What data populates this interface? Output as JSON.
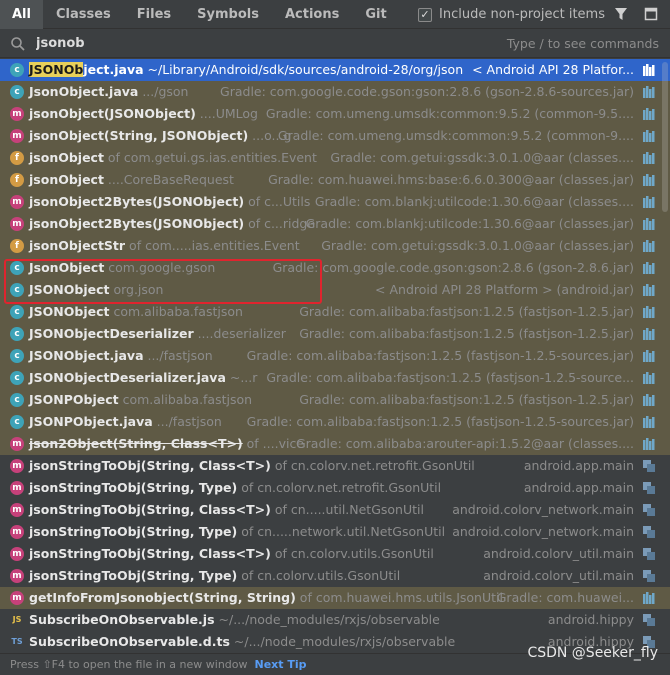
{
  "tabs": [
    "All",
    "Classes",
    "Files",
    "Symbols",
    "Actions",
    "Git"
  ],
  "include_label": "Include non-project items",
  "include_checked": "✓",
  "search": {
    "value": "jsonob",
    "hint": "Type / to see commands"
  },
  "results": [
    {
      "icon": "c",
      "pre": "",
      "match": "JSONOb",
      "post": "ject.java",
      "loc": " ~/Library/Android/sdk/sources/android-28/org/json",
      "src": "< Android API 28 Platfor...",
      "bg": "selected",
      "lib": true
    },
    {
      "icon": "c",
      "pre": "",
      "match": "",
      "post": "JsonObject.java",
      "loc": " .../gson",
      "src": "Gradle: com.google.code.gson:gson:2.8.6 (gson-2.8.6-sources.jar)",
      "bg": "lib",
      "lib": true
    },
    {
      "icon": "m",
      "pre": "",
      "match": "",
      "post": "jsonObject(JSONObject)",
      "loc": " ....UMLog",
      "src": "Gradle: com.umeng.umsdk:common:9.5.2 (common-9.5....",
      "bg": "lib",
      "lib": true
    },
    {
      "icon": "m",
      "pre": "",
      "match": "",
      "post": "jsonObject(String, JSONObject)",
      "loc": " ...o...g",
      "src": "Gradle: com.umeng.umsdk:common:9.5.2 (common-9....",
      "bg": "lib",
      "lib": true
    },
    {
      "icon": "f",
      "pre": "",
      "match": "",
      "post": "jsonObject",
      "loc": " of com.getui.gs.ias.entities.Event",
      "src": "Gradle: com.getui:gssdk:3.0.1.0@aar (classes....",
      "bg": "lib",
      "lib": true
    },
    {
      "icon": "f",
      "pre": "",
      "match": "",
      "post": "jsonObject",
      "loc": " ....CoreBaseRequest",
      "src": "Gradle: com.huawei.hms:base:6.6.0.300@aar (classes.jar)",
      "bg": "lib",
      "lib": true
    },
    {
      "icon": "m",
      "pre": "",
      "match": "",
      "post": "jsonObject2Bytes(JSONObject)",
      "loc": " of c...Utils",
      "src": "Gradle: com.blankj:utilcode:1.30.6@aar (classes....",
      "bg": "lib",
      "lib": true
    },
    {
      "icon": "m",
      "pre": "",
      "match": "",
      "post": "jsonObject2Bytes(JSONObject)",
      "loc": " of c...ridge",
      "src": "Gradle: com.blankj:utilcode:1.30.6@aar (classes.jar)",
      "bg": "lib",
      "lib": true
    },
    {
      "icon": "f",
      "pre": "",
      "match": "",
      "post": "jsonObjectStr",
      "loc": " of com.....ias.entities.Event",
      "src": "Gradle: com.getui:gssdk:3.0.1.0@aar (classes.jar)",
      "bg": "lib",
      "lib": true
    },
    {
      "icon": "c",
      "pre": "",
      "match": "",
      "post": "JsonObject",
      "loc": " com.google.gson",
      "src": "Gradle: com.google.code.gson:gson:2.8.6 (gson-2.8.6.jar)",
      "bg": "lib",
      "lib": true
    },
    {
      "icon": "c",
      "pre": "",
      "match": "",
      "post": "JSONObject",
      "loc": " org.json",
      "src": "< Android API 28 Platform > (android.jar)",
      "bg": "lib",
      "lib": true
    },
    {
      "icon": "c",
      "pre": "",
      "match": "",
      "post": "JSONObject",
      "loc": " com.alibaba.fastjson",
      "src": "Gradle: com.alibaba:fastjson:1.2.5 (fastjson-1.2.5.jar)",
      "bg": "lib",
      "lib": true
    },
    {
      "icon": "c",
      "pre": "",
      "match": "",
      "post": "JSONObjectDeserializer",
      "loc": " ....deserializer",
      "src": "Gradle: com.alibaba:fastjson:1.2.5 (fastjson-1.2.5.jar)",
      "bg": "lib",
      "lib": true
    },
    {
      "icon": "c",
      "pre": "",
      "match": "",
      "post": "JSONObject.java",
      "loc": " .../fastjson",
      "src": "Gradle: com.alibaba:fastjson:1.2.5 (fastjson-1.2.5-sources.jar)",
      "bg": "lib",
      "lib": true
    },
    {
      "icon": "c",
      "pre": "",
      "match": "",
      "post": "JSONObjectDeserializer.java",
      "loc": " ~...r",
      "src": "Gradle: com.alibaba:fastjson:1.2.5 (fastjson-1.2.5-source...",
      "bg": "lib",
      "lib": true
    },
    {
      "icon": "c",
      "pre": "",
      "match": "",
      "post": "JSONPObject",
      "loc": " com.alibaba.fastjson",
      "src": "Gradle: com.alibaba:fastjson:1.2.5 (fastjson-1.2.5.jar)",
      "bg": "lib",
      "lib": true
    },
    {
      "icon": "c",
      "pre": "",
      "match": "",
      "post": "JSONPObject.java",
      "loc": " .../fastjson",
      "src": "Gradle: com.alibaba:fastjson:1.2.5 (fastjson-1.2.5-sources.jar)",
      "bg": "lib",
      "lib": true
    },
    {
      "icon": "m",
      "pre": "",
      "match": "",
      "post": "json2Object(String, Class<T>)",
      "loc": " of ....vice",
      "src": "Gradle: com.alibaba:arouter-api:1.5.2@aar (classes....",
      "bg": "lib",
      "lib": true,
      "strike": true
    },
    {
      "icon": "m",
      "pre": "",
      "match": "",
      "post": "jsonStringToObj(String, Class<T>)",
      "loc": " of cn.colorv.net.retrofit.GsonUtil",
      "src": "android.app.main",
      "bg": "plain",
      "lib": false
    },
    {
      "icon": "m",
      "pre": "",
      "match": "",
      "post": "jsonStringToObj(String, Type)",
      "loc": " of cn.colorv.net.retrofit.GsonUtil",
      "src": "android.app.main",
      "bg": "plain",
      "lib": false
    },
    {
      "icon": "m",
      "pre": "",
      "match": "",
      "post": "jsonStringToObj(String, Class<T>)",
      "loc": " of cn.....util.NetGsonUtil",
      "src": "android.colorv_network.main",
      "bg": "plain",
      "lib": false
    },
    {
      "icon": "m",
      "pre": "",
      "match": "",
      "post": "jsonStringToObj(String, Type)",
      "loc": " of cn.....network.util.NetGsonUtil",
      "src": "android.colorv_network.main",
      "bg": "plain",
      "lib": false
    },
    {
      "icon": "m",
      "pre": "",
      "match": "",
      "post": "jsonStringToObj(String, Class<T>)",
      "loc": " of cn.colorv.utils.GsonUtil",
      "src": "android.colorv_util.main",
      "bg": "plain",
      "lib": false
    },
    {
      "icon": "m",
      "pre": "",
      "match": "",
      "post": "jsonStringToObj(String, Type)",
      "loc": " of cn.colorv.utils.GsonUtil",
      "src": "android.colorv_util.main",
      "bg": "plain",
      "lib": false
    },
    {
      "icon": "m",
      "pre": "",
      "match": "",
      "post": "getInfoFromJsonobject(String, String)",
      "loc": " of com.huawei.hms.utils.JsonUtil",
      "src": "Gradle: com.huawei...",
      "bg": "lib",
      "lib": true
    },
    {
      "icon": "js",
      "pre": "",
      "match": "",
      "post": "SubscribeOnObservable.js",
      "loc": " ~/.../node_modules/rxjs/observable",
      "src": "android.hippy",
      "bg": "plain",
      "lib": false
    },
    {
      "icon": "ts",
      "pre": "",
      "match": "",
      "post": "SubscribeOnObservable.d.ts",
      "loc": " ~/.../node_modules/rxjs/observable",
      "src": "android.hippy",
      "bg": "plain",
      "lib": false
    }
  ],
  "footer": {
    "hint": "Press ⇧F4 to open the file in a new window",
    "next_tip": "Next Tip"
  },
  "watermark": "CSDN @Seeker_fly"
}
